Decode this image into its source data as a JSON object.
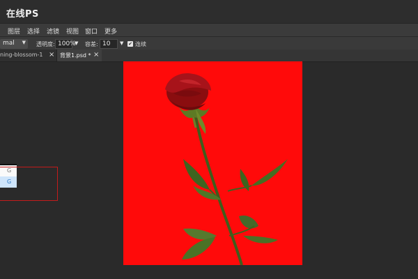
{
  "app": {
    "title": "在线PS"
  },
  "menu": {
    "items": [
      "图层",
      "选择",
      "滤镜",
      "视图",
      "窗口",
      "更多"
    ]
  },
  "options": {
    "blend_mode": "mal",
    "opacity_label": "透明度:",
    "opacity_value": "100%",
    "tolerance_label": "容差:",
    "tolerance_value": "10",
    "contiguous_label": "连续",
    "contiguous_checked": true
  },
  "tabs": [
    {
      "label": "ning-blossom-1",
      "active": false
    },
    {
      "label": "背景1.psd *",
      "active": true
    }
  ],
  "layers": [
    {
      "label": "G",
      "selected": false
    },
    {
      "label": "G",
      "selected": true
    }
  ],
  "colors": {
    "canvas_background": "#ff0a0a",
    "highlight": "#c41b1b",
    "selected_layer": "#cfe5fb"
  },
  "icons": {
    "close": "×",
    "dropdown": "▼",
    "check": "✔"
  }
}
